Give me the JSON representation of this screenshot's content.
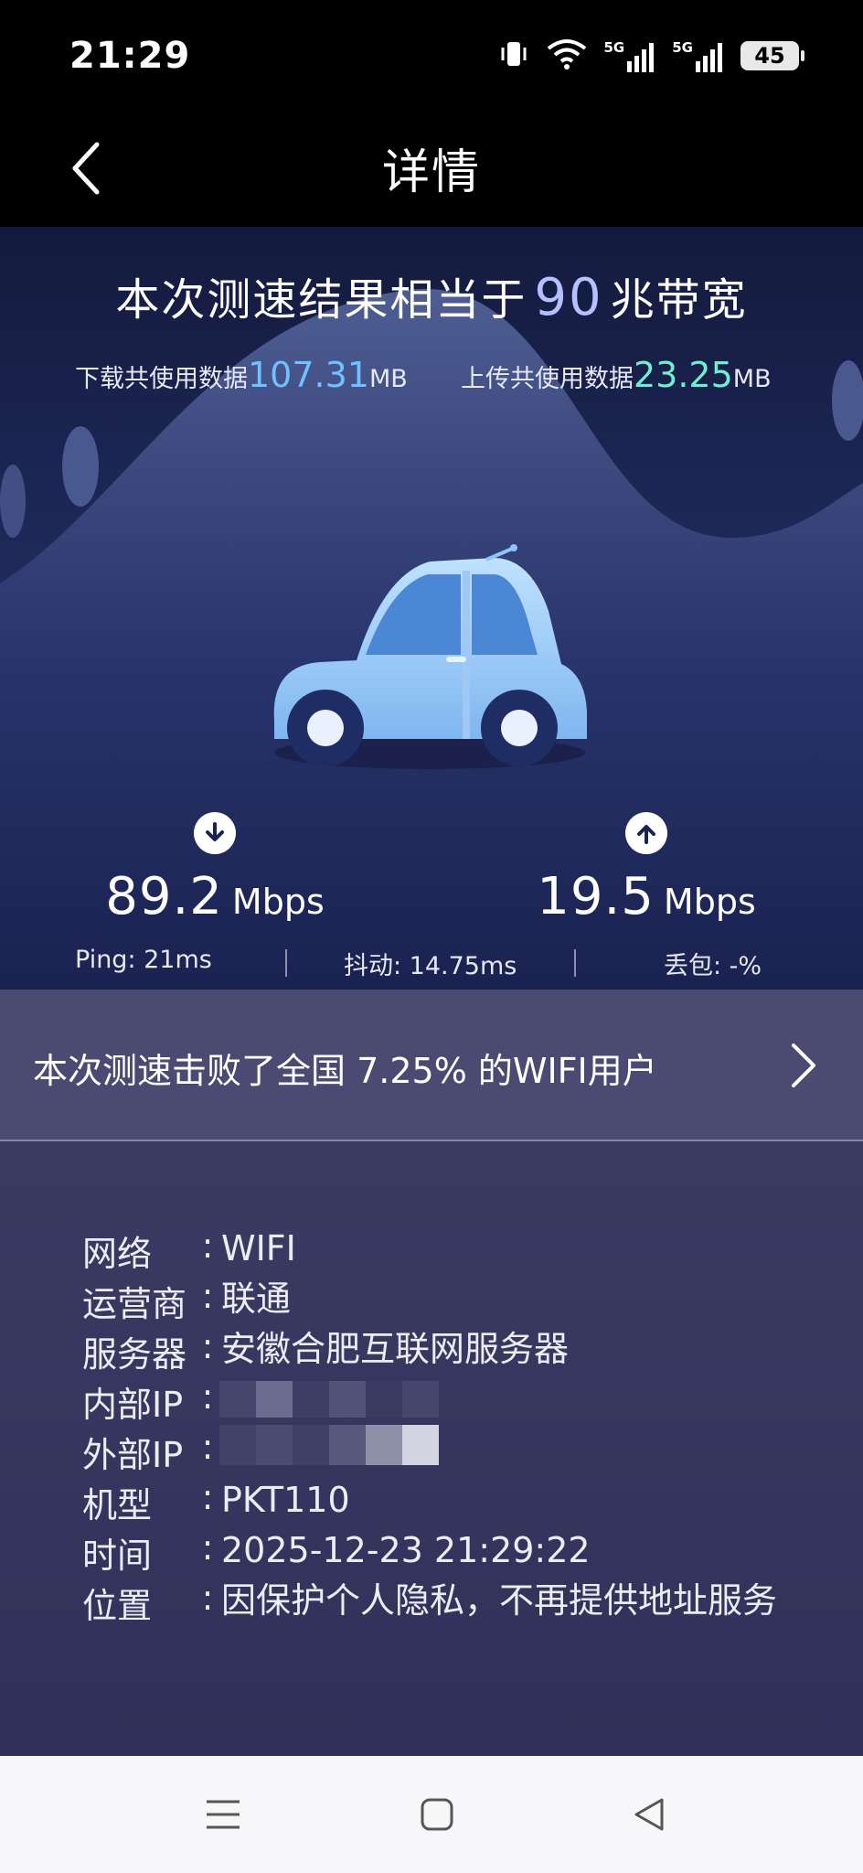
{
  "status_bar": {
    "time": "21:29",
    "battery": "45",
    "signal_1": "5G",
    "signal_2": "5G"
  },
  "header": {
    "title": "详情"
  },
  "hero": {
    "equiv_prefix": "本次测速结果相当于",
    "equiv_value": "90",
    "equiv_suffix": "兆带宽",
    "download_usage_label": "下载共使用数据",
    "download_usage_value": "107.31",
    "download_usage_unit": "MB",
    "upload_usage_label": "上传共使用数据",
    "upload_usage_value": "23.25",
    "upload_usage_unit": "MB",
    "download_speed": "89.2",
    "upload_speed": "19.5",
    "speed_unit": "Mbps",
    "ping": "Ping:  21ms",
    "jitter": "抖动:  14.75ms",
    "packet_loss": "丢包:  -%"
  },
  "beat_banner": {
    "text": "本次测速击败了全国 7.25% 的WIFI用户"
  },
  "info": [
    {
      "label": "网络",
      "value": "WIFI"
    },
    {
      "label": "运营商",
      "value": "联通"
    },
    {
      "label": "服务器",
      "value": "安徽合肥互联网服务器"
    },
    {
      "label": "内部IP",
      "value": ""
    },
    {
      "label": "外部IP",
      "value": ""
    },
    {
      "label": "机型",
      "value": "PKT110"
    },
    {
      "label": "时间",
      "value": "2025-12-23 21:29:22"
    },
    {
      "label": "位置",
      "value": "因保护个人隐私，不再提供地址服务"
    }
  ],
  "colors": {
    "download_accent": "#6fc1ff",
    "upload_accent": "#6ef0d0",
    "equiv_accent": "#b7c0ff",
    "banner_bg": "#4a4a72"
  },
  "icons": {
    "back": "chevron-left-icon",
    "banner_arrow": "chevron-right-icon",
    "download": "arrow-down-circle-icon",
    "upload": "arrow-up-circle-icon",
    "nav_menu": "menu-icon",
    "nav_home": "square-home-icon",
    "nav_back": "triangle-back-icon"
  }
}
